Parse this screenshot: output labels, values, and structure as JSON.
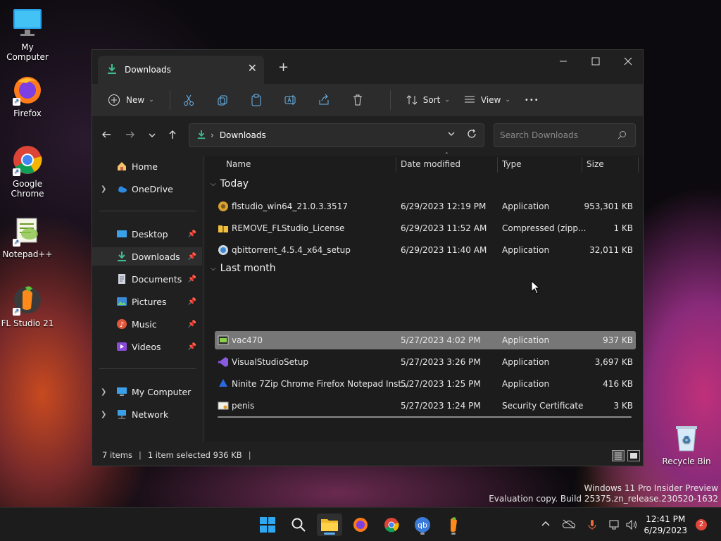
{
  "desktop": {
    "icons": [
      {
        "label": "My Computer"
      },
      {
        "label": "Firefox"
      },
      {
        "label": "Google Chrome"
      },
      {
        "label": "Notepad++"
      },
      {
        "label": "FL Studio 21"
      },
      {
        "label": "Recycle Bin"
      }
    ],
    "watermark": {
      "line1": "Windows 11 Pro Insider Preview",
      "line2": "Evaluation copy. Build 25375.zn_release.230520-1632"
    }
  },
  "window": {
    "tab_title": "Downloads",
    "close_tab_glyph": "✕",
    "new_tab_glyph": "+",
    "toolbar": {
      "new_label": "New",
      "sort_label": "Sort",
      "view_label": "View",
      "more_glyph": "•••"
    },
    "address": {
      "path_label": "Downloads",
      "separator": "›",
      "search_placeholder": "Search Downloads"
    },
    "sidebar": {
      "home": "Home",
      "onedrive": "OneDrive",
      "desktop": "Desktop",
      "downloads": "Downloads",
      "documents": "Documents",
      "pictures": "Pictures",
      "music": "Music",
      "videos": "Videos",
      "my_computer": "My Computer",
      "network": "Network"
    },
    "columns": {
      "name": "Name",
      "date": "Date modified",
      "type": "Type",
      "size": "Size"
    },
    "groups": {
      "today": "Today",
      "last_month": "Last month"
    },
    "files_today": [
      {
        "name": "flstudio_win64_21.0.3.3517",
        "date": "6/29/2023 12:19 PM",
        "type": "Application",
        "size": "953,301 KB"
      },
      {
        "name": "REMOVE_FLStudio_License",
        "date": "6/29/2023 11:52 AM",
        "type": "Compressed (zipp...",
        "size": "1 KB"
      },
      {
        "name": "qbittorrent_4.5.4_x64_setup",
        "date": "6/29/2023 11:40 AM",
        "type": "Application",
        "size": "32,011 KB"
      }
    ],
    "files_last_month": [
      {
        "name": "vac470",
        "date": "5/27/2023 4:02 PM",
        "type": "Application",
        "size": "937 KB"
      },
      {
        "name": "VisualStudioSetup",
        "date": "5/27/2023 3:26 PM",
        "type": "Application",
        "size": "3,697 KB"
      },
      {
        "name": "Ninite 7Zip Chrome Firefox Notepad Inst...",
        "date": "5/27/2023 1:25 PM",
        "type": "Application",
        "size": "416 KB"
      },
      {
        "name": "penis",
        "date": "5/27/2023 1:24 PM",
        "type": "Security Certificate",
        "size": "3 KB"
      }
    ],
    "status": {
      "items": "7 items",
      "selected": "1 item selected  936 KB"
    }
  },
  "taskbar": {
    "clock_time": "12:41 PM",
    "clock_date": "6/29/2023",
    "notification_count": "2"
  },
  "colors": {
    "accent": "#4cc2ff",
    "download_green": "#3fbf8f",
    "selection": "#777777"
  }
}
